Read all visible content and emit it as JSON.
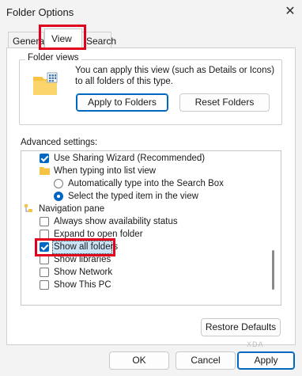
{
  "window": {
    "title": "Folder Options",
    "close_glyph": "✕"
  },
  "tabs": [
    {
      "label": "General"
    },
    {
      "label": "View"
    },
    {
      "label": "Search"
    }
  ],
  "folder_views": {
    "group_label": "Folder views",
    "description": "You can apply this view (such as Details or Icons) to all folders of this type.",
    "apply_button": "Apply to Folders",
    "reset_button": "Reset Folders"
  },
  "advanced": {
    "label": "Advanced settings:",
    "items": [
      {
        "type": "checkbox",
        "checked": true,
        "label": "Use Sharing Wizard (Recommended)"
      },
      {
        "type": "folder",
        "label": "When typing into list view"
      },
      {
        "type": "radio",
        "checked": false,
        "label": "Automatically type into the Search Box"
      },
      {
        "type": "radio",
        "checked": true,
        "label": "Select the typed item in the view"
      },
      {
        "type": "navfolder",
        "label": "Navigation pane"
      },
      {
        "type": "checkbox",
        "checked": false,
        "label": "Always show availability status"
      },
      {
        "type": "checkbox",
        "checked": false,
        "label": "Expand to open folder"
      },
      {
        "type": "checkbox",
        "checked": true,
        "label": "Show all folders"
      },
      {
        "type": "checkbox",
        "checked": false,
        "label": "Show libraries"
      },
      {
        "type": "checkbox",
        "checked": false,
        "label": "Show Network"
      },
      {
        "type": "checkbox",
        "checked": false,
        "label": "Show This PC"
      }
    ]
  },
  "restore_button": "Restore Defaults",
  "footer": {
    "ok": "OK",
    "cancel": "Cancel",
    "apply": "Apply"
  },
  "watermark": "XDA",
  "colors": {
    "accent": "#0067c0",
    "highlight": "#e0001b",
    "folder": "#f6c344"
  }
}
